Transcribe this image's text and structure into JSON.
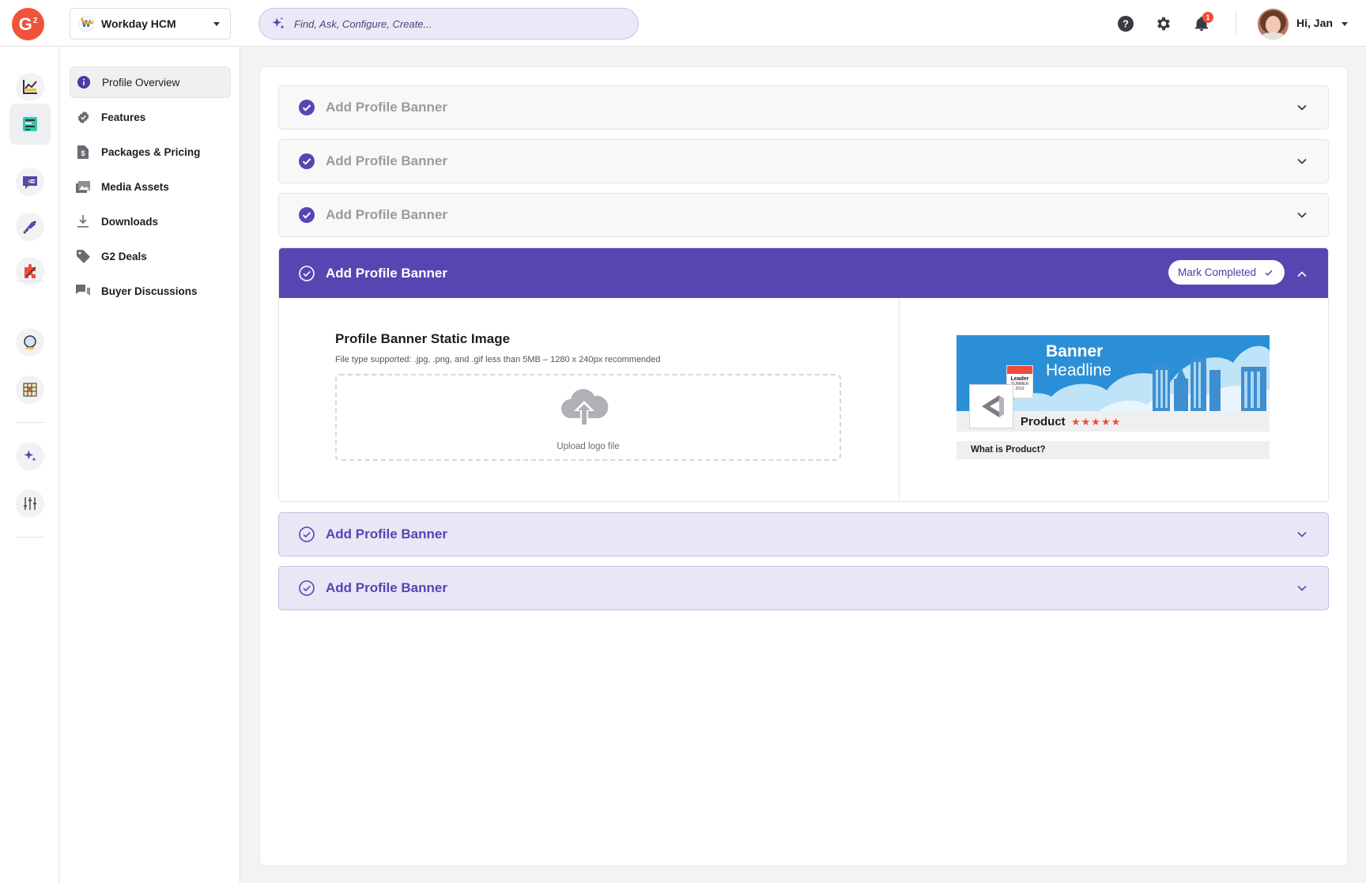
{
  "app": {
    "logo_text": "G",
    "logo_sup": "2"
  },
  "header": {
    "product": {
      "name": "Workday HCM",
      "logo_letter": "W"
    },
    "search": {
      "placeholder": "Find, Ask, Configure, Create..."
    },
    "notifications_count": "1",
    "user_greeting": "Hi, Jan",
    "icons": [
      "help-icon",
      "gear-icon",
      "bell-icon"
    ]
  },
  "rail": {
    "items": [
      "analytics-icon",
      "profile-icon",
      "reviews-icon",
      "marketing-icon",
      "integrations-icon",
      "insights-icon",
      "reports-icon",
      "ai-sparkle-icon",
      "settings-sliders-icon"
    ],
    "active": "profile-icon"
  },
  "sidebar": {
    "items": [
      {
        "label": "Profile Overview",
        "icon": "info-icon",
        "active": true
      },
      {
        "label": "Features",
        "icon": "badge-check-icon"
      },
      {
        "label": "Packages & Pricing",
        "icon": "pricing-doc-icon"
      },
      {
        "label": "Media Assets",
        "icon": "images-icon"
      },
      {
        "label": "Downloads",
        "icon": "download-icon"
      },
      {
        "label": "G2 Deals",
        "icon": "tag-icon"
      },
      {
        "label": "Buyer Discussions",
        "icon": "chat-icon"
      }
    ]
  },
  "main": {
    "sections": [
      {
        "title": "Add Profile Banner",
        "state": "completed"
      },
      {
        "title": "Add Profile Banner",
        "state": "completed"
      },
      {
        "title": "Add Profile Banner",
        "state": "completed"
      },
      {
        "title": "Add Profile Banner",
        "state": "open"
      },
      {
        "title": "Add Profile Banner",
        "state": "incomplete"
      },
      {
        "title": "Add Profile Banner",
        "state": "incomplete"
      }
    ],
    "open_section": {
      "mark_completed_label": "Mark Completed",
      "field_title": "Profile Banner Static Image",
      "field_hint": "File type supported: .jpg, .png, and .gif less than 5MB – 1280 x 240px recommended",
      "upload_label": "Upload logo file",
      "preview": {
        "headline_line1": "Banner",
        "headline_line2": "Headline",
        "badge_label": "Leader",
        "badge_sub": "SUMMER",
        "badge_year": "2019",
        "product_name": "Product",
        "stars": "★★★★★",
        "what_is": "What is Product?"
      }
    }
  },
  "colors": {
    "brand": "#f0523a",
    "accent": "#5646b1",
    "accent_light": "#e9e6f6",
    "check": "#5646b1"
  }
}
